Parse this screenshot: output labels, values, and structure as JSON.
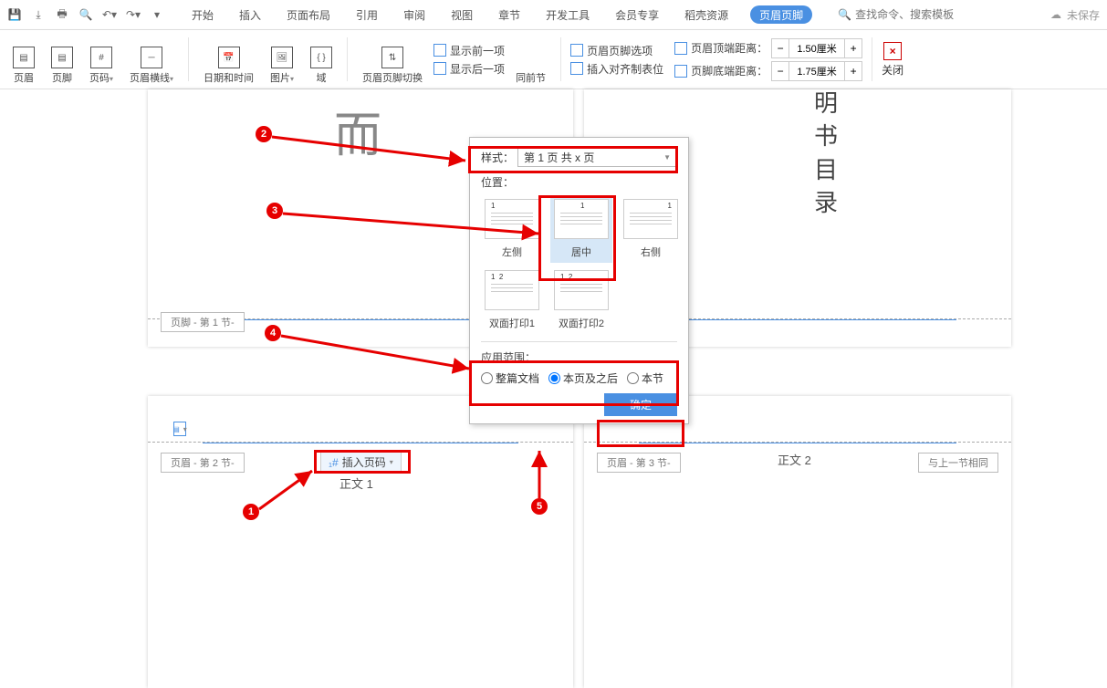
{
  "titlebar": {
    "tabs": [
      "开始",
      "插入",
      "页面布局",
      "引用",
      "审阅",
      "视图",
      "章节",
      "开发工具",
      "会员专享",
      "稻壳资源",
      "页眉页脚"
    ],
    "active_tab": 10,
    "search_placeholder": "查找命令、搜索模板",
    "unsaved": "未保存"
  },
  "ribbon": {
    "groups_left": [
      {
        "label": "页眉"
      },
      {
        "label": "页脚"
      },
      {
        "label": "页码"
      },
      {
        "label": "页眉横线"
      },
      {
        "label": "日期和时间"
      },
      {
        "label": "图片"
      },
      {
        "label": "域"
      },
      {
        "label": "页眉页脚切换"
      }
    ],
    "mid_col": {
      "prev": "显示前一项",
      "next": "显示后一项",
      "same": "同前节"
    },
    "right_col": {
      "options": "页眉页脚选项",
      "align_tab": "插入对齐制表位"
    },
    "dist": {
      "top_label": "页眉顶端距离：",
      "top_value": "1.50厘米",
      "bottom_label": "页脚底端距离：",
      "bottom_value": "1.75厘米"
    },
    "close": "关闭"
  },
  "pages": {
    "tl": {
      "glyph": "而",
      "footer_tag": "页脚 - 第 1 节-"
    },
    "tr": {
      "col_chars": [
        "明",
        "书",
        "目",
        "录"
      ],
      "footer_tag": "页脚 - 第 1 节-"
    },
    "bl": {
      "header_tag": "页眉 - 第 2 节-",
      "body": "正文 1"
    },
    "br": {
      "header_tag": "页眉 - 第 3 节-",
      "same_tag": "与上一节相同",
      "body": "正文 2"
    }
  },
  "popup": {
    "style_label": "样式：",
    "style_value": "第 1 页 共 x 页",
    "position_label": "位置：",
    "positions": [
      "左侧",
      "居中",
      "右侧",
      "双面打印1",
      "双面打印2"
    ],
    "scope_label": "应用范围：",
    "scope_options": [
      "整篇文档",
      "本页及之后",
      "本节"
    ],
    "scope_selected": 1,
    "ok_button": "确定"
  },
  "insert_pn_button": "插入页码",
  "bubbles": [
    "1",
    "2",
    "3",
    "4",
    "5"
  ]
}
